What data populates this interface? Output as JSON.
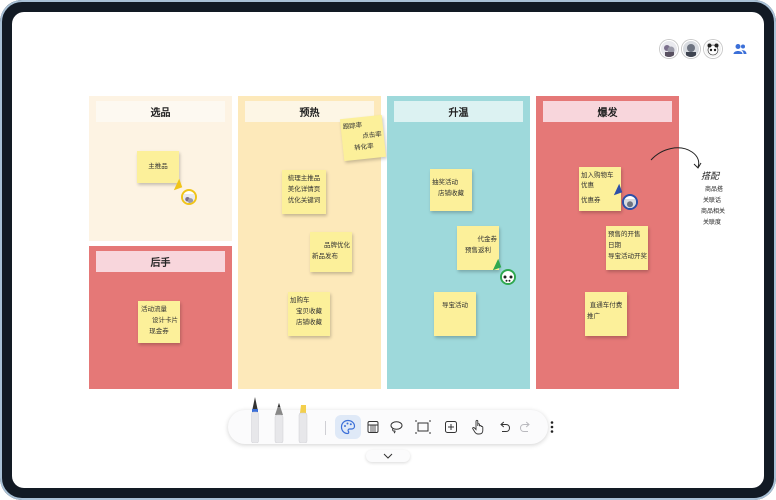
{
  "columns": [
    {
      "id": "xuanpin",
      "title": "选品",
      "bg": "#fdf3e3",
      "header_bg": "#fdf9f1"
    },
    {
      "id": "houshou",
      "title": "后手",
      "bg": "#e57877",
      "header_bg": "#f8d6dc"
    },
    {
      "id": "yure",
      "title": "预热",
      "bg": "#fde9ba",
      "header_bg": "#fdf6e5"
    },
    {
      "id": "shengwen",
      "title": "升温",
      "bg": "#9ed9db",
      "header_bg": "#dcf2f2"
    },
    {
      "id": "baofa",
      "title": "爆发",
      "bg": "#e57877",
      "header_bg": "#f8d6dc"
    }
  ],
  "notes": {
    "zhutuipin": [
      "主推品"
    ],
    "huodong_liuliang": [
      "活动流量",
      "设计卡片",
      "现金券"
    ],
    "shuli": [
      "梳理主推品",
      "美化详情页",
      "优化关键词"
    ],
    "guanzhu": [
      "跟踪率",
      "点击率",
      "转化率"
    ],
    "pinpai": [
      "品牌优化",
      "新品发布"
    ],
    "jiagou": [
      "加购车",
      "宝贝收藏",
      "店铺收藏"
    ],
    "chengjiang": [
      "抽奖活动",
      "店铺收藏"
    ],
    "daijinquan": [
      "代金券",
      "预售返利"
    ],
    "taobao_huodong": [
      "导宝活动"
    ],
    "jiaru": [
      "加入购物车",
      "优惠",
      "优惠券"
    ],
    "yushou": [
      "预售的开售",
      "日期",
      "导宝活动开奖"
    ],
    "zhitongche": [
      "直通车付费",
      "推广"
    ]
  },
  "handwriting": {
    "title": "搭配",
    "lines": [
      "商品搭",
      "关联话",
      "商品相关",
      "关联度"
    ]
  },
  "toolbar": {
    "tools": [
      "pen-tool",
      "pencil-tool",
      "highlighter-tool",
      "palette-tool",
      "eraser-tool",
      "lasso-tool",
      "select-box-tool",
      "add-tool",
      "hand-tool",
      "undo-tool",
      "redo-tool",
      "more-tool"
    ],
    "active": "palette-tool"
  },
  "colors": {
    "accent": "#3b6fd8",
    "cursor_yellow": "#f0c419",
    "cursor_green": "#2fa84f",
    "cursor_blue": "#2c4fa8"
  }
}
